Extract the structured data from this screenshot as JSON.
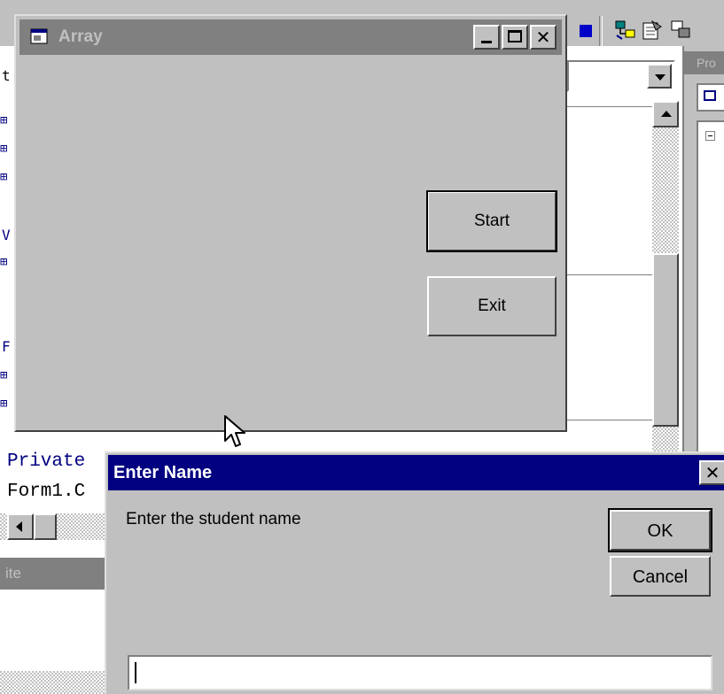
{
  "ide": {
    "code_lines": [
      "Private",
      "Form1.C"
    ],
    "properties_title": "Pro",
    "immediate_title": "ite",
    "left_letters": [
      "t",
      "V",
      "F"
    ],
    "stop_color": "#0000c8"
  },
  "array_window": {
    "title": "Array",
    "icon": "form-icon",
    "buttons": {
      "start_label": "Start",
      "exit_label": "Exit"
    },
    "title_controls": [
      "minimize-icon",
      "maximize-icon",
      "close-icon"
    ]
  },
  "dialog": {
    "title": "Enter Name",
    "prompt": "Enter the student name",
    "ok_label": "OK",
    "cancel_label": "Cancel",
    "input_value": "",
    "titlebar_color": "#000080"
  }
}
